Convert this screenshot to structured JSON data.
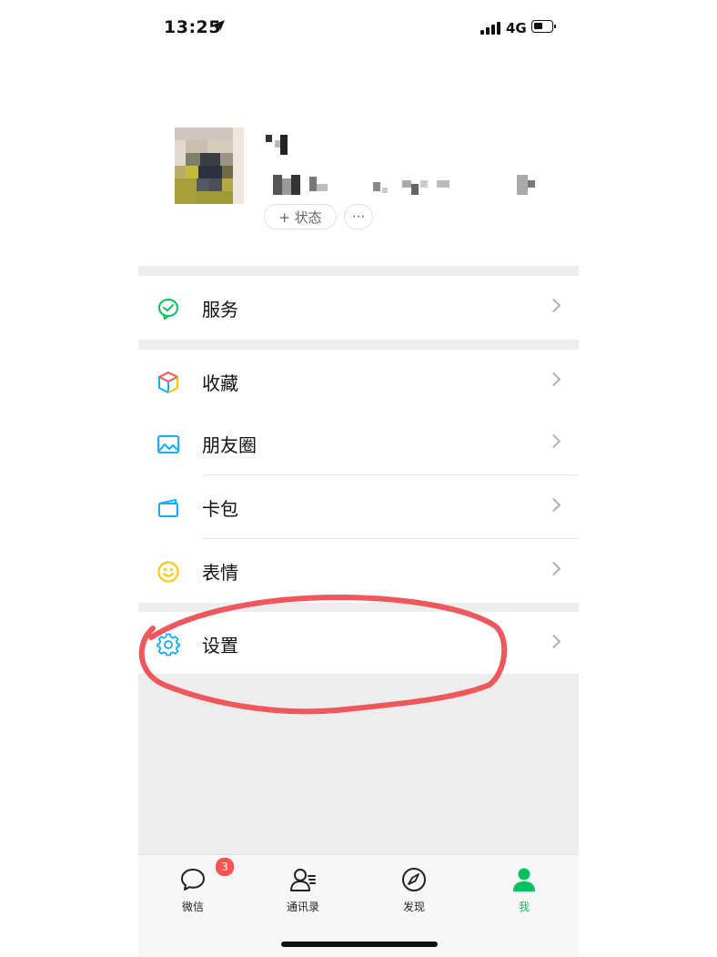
{
  "status_bar": {
    "time": "13:25",
    "network": "4G"
  },
  "profile": {
    "status_button": "+ 状态",
    "more_button": "···"
  },
  "menu": {
    "service": "服务",
    "favorites": "收藏",
    "moments": "朋友圈",
    "cards": "卡包",
    "stickers": "表情",
    "settings": "设置"
  },
  "tabbar": {
    "chats": {
      "label": "微信",
      "badge": "3"
    },
    "contacts": {
      "label": "通讯录"
    },
    "discover": {
      "label": "发现"
    },
    "me": {
      "label": "我"
    }
  },
  "colors": {
    "accent": "#07c160",
    "badge": "#fa5151",
    "annotation": "#f0575c"
  }
}
